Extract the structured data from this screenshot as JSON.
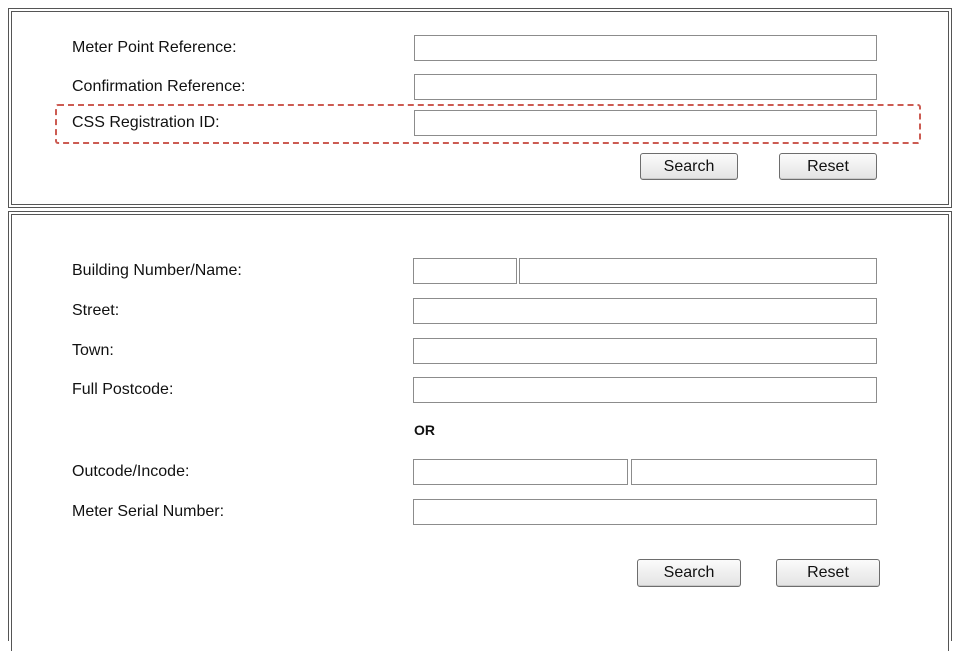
{
  "reference_search": {
    "fields": [
      {
        "label": "Meter Point Reference:",
        "value": ""
      },
      {
        "label": "Confirmation Reference:",
        "value": ""
      },
      {
        "label": "CSS Registration ID:",
        "value": ""
      }
    ],
    "search_label": "Search",
    "reset_label": "Reset"
  },
  "address_search": {
    "building_label": "Building Number/Name:",
    "building_number_value": "",
    "building_name_value": "",
    "street_label": "Street:",
    "street_value": "",
    "town_label": "Town:",
    "town_value": "",
    "postcode_label": "Full Postcode:",
    "postcode_value": "",
    "or_label": "OR",
    "outcode_label": "Outcode/Incode:",
    "outcode_value": "",
    "incode_value": "",
    "meter_serial_label": "Meter Serial Number:",
    "meter_serial_value": "",
    "search_label": "Search",
    "reset_label": "Reset"
  },
  "colors": {
    "border": "#555555",
    "field_border": "#8c8c8c",
    "highlight": "#cc5b52"
  }
}
